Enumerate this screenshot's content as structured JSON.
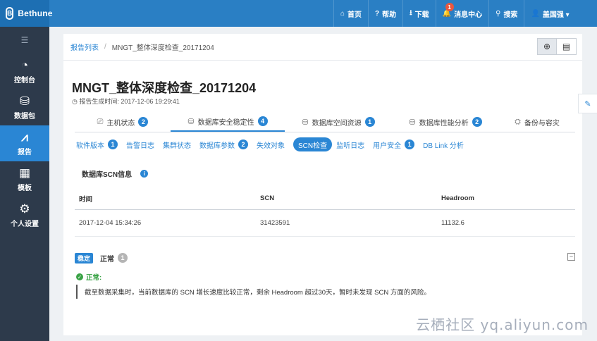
{
  "app": {
    "name": "Bethune",
    "logo_glyph": "B"
  },
  "topnav": [
    {
      "icon": "home-icon",
      "glyph": "⌂",
      "label": "首页"
    },
    {
      "icon": "help-icon",
      "glyph": "?",
      "label": "帮助"
    },
    {
      "icon": "download-icon",
      "glyph": "⭳",
      "label": "下载"
    },
    {
      "icon": "bell-icon",
      "glyph": "🔔",
      "label": "消息中心",
      "badge": "1"
    },
    {
      "icon": "search-icon",
      "glyph": "⚲",
      "label": "搜索"
    },
    {
      "icon": "user-icon",
      "glyph": "👤",
      "label": "盖国强 ▾"
    }
  ],
  "sidebar": {
    "toggle_glyph": "☰",
    "items": [
      {
        "icon": "dashboard-icon",
        "glyph": "◔",
        "label": "控制台"
      },
      {
        "icon": "package-icon",
        "glyph": "⛁",
        "label": "数据包"
      },
      {
        "icon": "chart-icon",
        "glyph": "⩘",
        "label": "报告",
        "active": true
      },
      {
        "icon": "grid-icon",
        "glyph": "▦",
        "label": "模板"
      },
      {
        "icon": "gear-icon",
        "glyph": "⚙",
        "label": "个人设置"
      }
    ]
  },
  "breadcrumb": {
    "link": "报告列表",
    "separator": "/",
    "current": "MNGT_整体深度检查_20171204"
  },
  "view_buttons": [
    {
      "icon": "zoom-icon",
      "glyph": "⊕"
    },
    {
      "icon": "list-icon",
      "glyph": "▤"
    }
  ],
  "report": {
    "title": "MNGT_整体深度检查_20171204",
    "time_prefix": "◷ 报告生成时间: ",
    "time_value": "2017-12-06 19:29:41"
  },
  "tabs1": [
    {
      "glyph": "⎚",
      "label": "主机状态",
      "badge": "2"
    },
    {
      "glyph": "⛁",
      "label": "数据库安全稳定性",
      "badge": "4",
      "active": true
    },
    {
      "glyph": "⛁",
      "label": "数据库空间资源",
      "badge": "1"
    },
    {
      "glyph": "⛁",
      "label": "数据库性能分析",
      "badge": "2"
    },
    {
      "glyph": "⛭",
      "label": "备份与容灾",
      "badge": ""
    }
  ],
  "tabs2": [
    {
      "label": "软件版本",
      "badge": "1"
    },
    {
      "label": "告警日志",
      "badge": ""
    },
    {
      "label": "集群状态",
      "badge": ""
    },
    {
      "label": "数据库参数",
      "badge": "2"
    },
    {
      "label": "失效对象",
      "badge": ""
    },
    {
      "label": "SCN检查",
      "badge": "",
      "active": true
    },
    {
      "label": "监听日志",
      "badge": ""
    },
    {
      "label": "用户安全",
      "badge": "1"
    },
    {
      "label": "DB Link 分析",
      "badge": ""
    }
  ],
  "section": {
    "title": "数据库SCN信息",
    "info_glyph": "i"
  },
  "table": {
    "headers": [
      "时间",
      "SCN",
      "Headroom"
    ],
    "rows": [
      [
        "2017-12-04 15:34:26",
        "31423591",
        "11132.6"
      ]
    ]
  },
  "status": {
    "tag": "稳定",
    "label": "正常",
    "count": "1",
    "collapse_glyph": "−"
  },
  "result": {
    "ok_glyph": "✓",
    "ok_label": "正常:",
    "detail": "截至数据采集时，当前数据库的 SCN 增长速度比较正常，剩余 Headroom 超过30天，暂时未发现 SCN 方面的风险。"
  },
  "side_edit_glyph": "✎",
  "watermark": "云栖社区 yq.aliyun.com"
}
